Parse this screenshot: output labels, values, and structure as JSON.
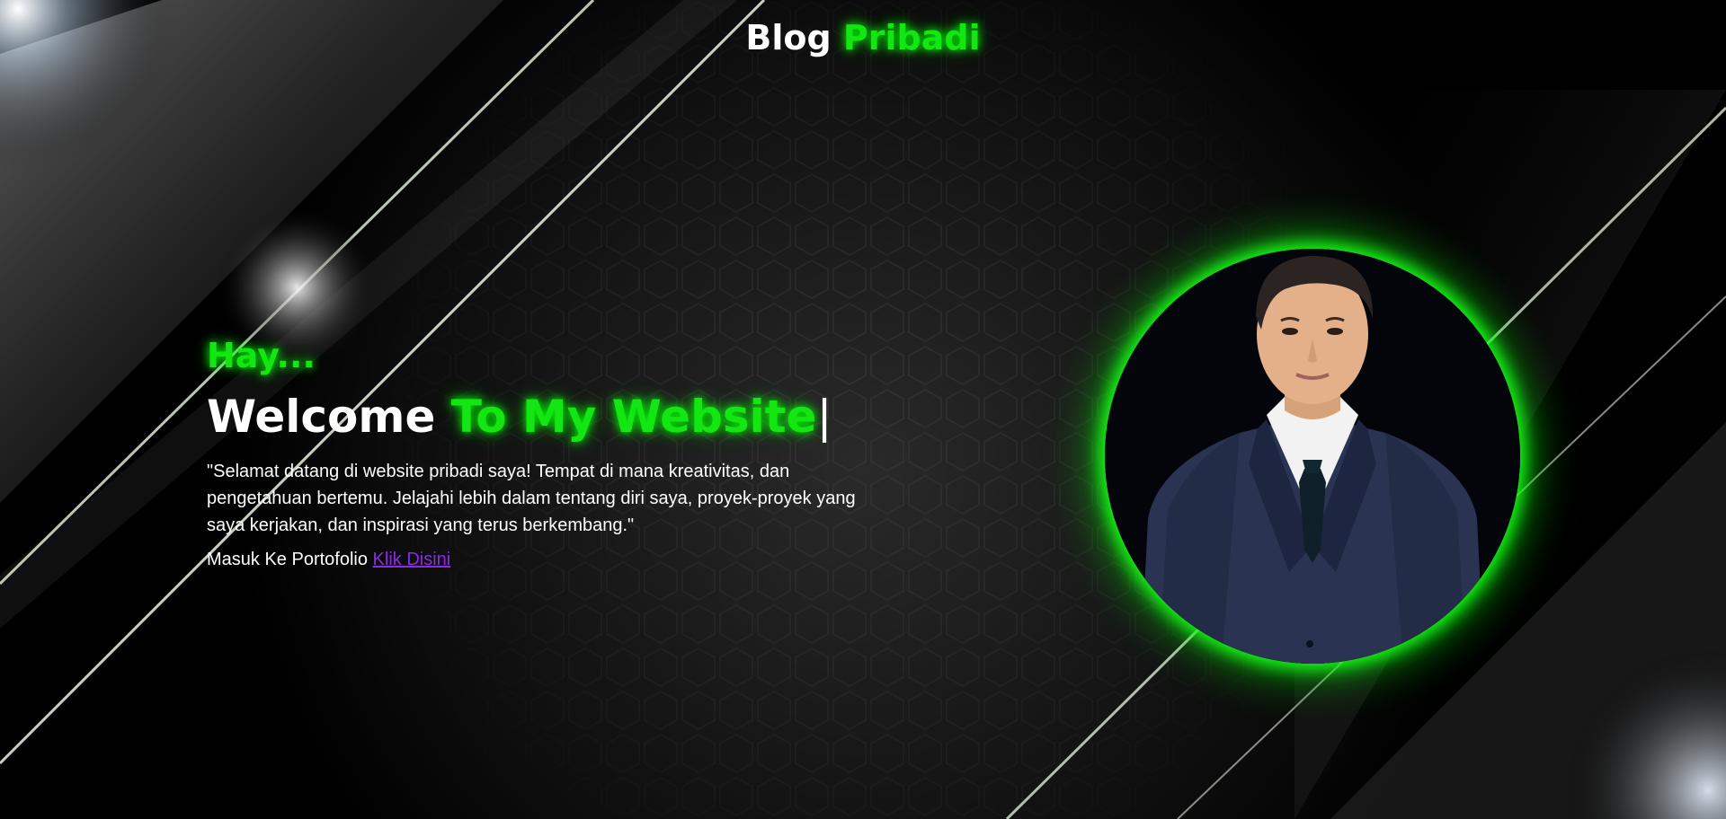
{
  "header": {
    "title_part1": "Blog ",
    "title_part2": "Pribadi"
  },
  "hero": {
    "greeting": "Hay...",
    "welcome_part1": "Welcome ",
    "welcome_part2": "To My Website",
    "caret": "|",
    "intro": "\"Selamat datang di website pribadi saya! Tempat di mana kreativitas, dan pengetahuan bertemu. Jelajahi lebih dalam tentang diri saya, proyek-proyek yang saya kerjakan, dan inspirasi yang terus berkembang.\"",
    "portfolio_label": "Masuk Ke Portofolio ",
    "portfolio_link": "Klik Disini"
  },
  "colors": {
    "accent": "#13e613",
    "link": "#8a2be2",
    "background": "#000000"
  },
  "profile_photo": {
    "icon": "profile-photo-avatar"
  }
}
